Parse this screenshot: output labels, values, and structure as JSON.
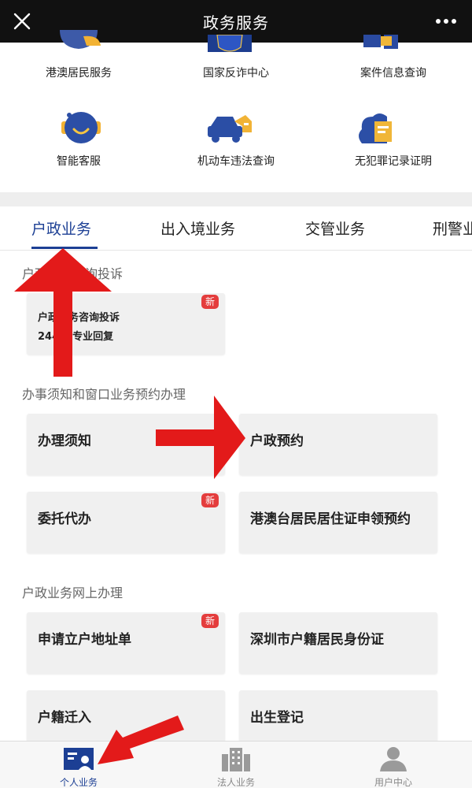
{
  "header": {
    "title": "政务服务",
    "close_icon": "close-icon",
    "more_icon": "more-icon"
  },
  "services": [
    {
      "label": "港澳居民服务",
      "icon": "passport-person-icon"
    },
    {
      "label": "国家反诈中心",
      "icon": "police-badge-icon"
    },
    {
      "label": "案件信息查询",
      "icon": "case-folder-icon"
    },
    {
      "label": "智能客服",
      "icon": "robot-service-icon"
    },
    {
      "label": "机动车违法查询",
      "icon": "car-violation-icon"
    },
    {
      "label": "无犯罪记录证明",
      "icon": "certificate-icon"
    }
  ],
  "tabs": [
    {
      "label": "户政业务",
      "active": true
    },
    {
      "label": "出入境业务",
      "active": false
    },
    {
      "label": "交管业务",
      "active": false
    },
    {
      "label": "刑警业",
      "active": false
    }
  ],
  "sections": [
    {
      "title": "户政业务咨询投诉",
      "cards": [
        {
          "title": "户政业务咨询投诉",
          "subtitle": "24小时专业回复",
          "badge": "新"
        }
      ]
    },
    {
      "title": "办事须知和窗口业务预约办理",
      "cards": [
        {
          "title": "办理须知"
        },
        {
          "title": "户政预约"
        },
        {
          "title": "委托代办",
          "badge": "新"
        },
        {
          "title": "港澳台居民居住证申领预约"
        }
      ]
    },
    {
      "title": "户政业务网上办理",
      "cards": [
        {
          "title": "申请立户地址单",
          "badge": "新"
        },
        {
          "title": "深圳市户籍居民身份证"
        },
        {
          "title": "户籍迁入"
        },
        {
          "title": "出生登记"
        }
      ]
    }
  ],
  "bottom_nav": [
    {
      "label": "个人业务",
      "icon": "personal-card-icon",
      "active": true
    },
    {
      "label": "法人业务",
      "icon": "building-icon",
      "active": false
    },
    {
      "label": "用户中心",
      "icon": "user-icon",
      "active": false
    }
  ],
  "colors": {
    "accent": "#1c3f94",
    "badge": "#e43d3d",
    "arrow": "#e31a1a",
    "topbar": "#111111"
  }
}
